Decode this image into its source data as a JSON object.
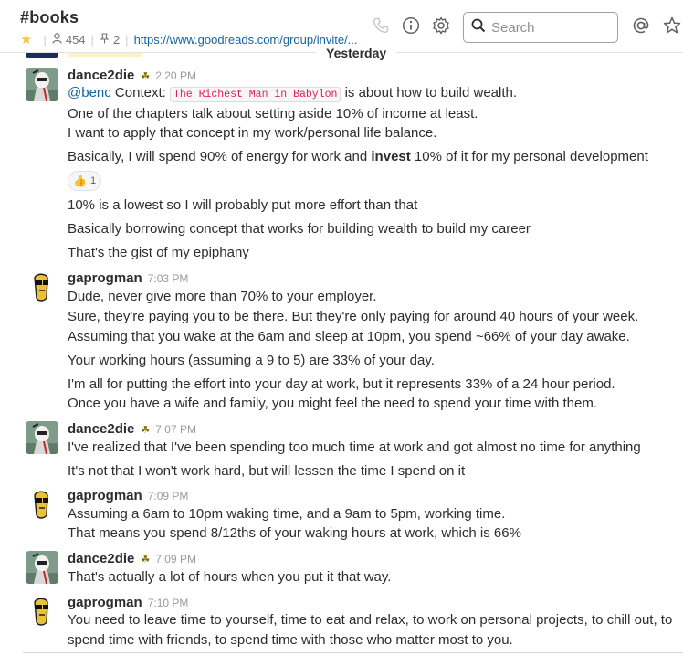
{
  "channel": {
    "title": "#books",
    "members": "454",
    "pins": "2",
    "link": "https://www.goodreads.com/group/invite/..."
  },
  "header": {
    "search_placeholder": "Search",
    "icons": [
      "phone-icon",
      "info-icon",
      "gear-icon",
      "search-icon",
      "at-icon",
      "star-icon"
    ]
  },
  "day_divider": "Yesterday",
  "messages": [
    {
      "sender": "dance2die",
      "time": "2:20 PM",
      "mention": "@benc",
      "context_prefix": " Context: ",
      "code": "The Richest Man in Babylon",
      "context_suffix": " is about how to build wealth.",
      "line2": "One of the chapters talk about setting aside 10% of income at least.",
      "line3": "I want to apply that concept in my work/personal life balance.",
      "line4_pre": "Basically, I will spend 90% of energy for work and ",
      "line4_bold": "invest",
      "line4_post": " 10% of it for my personal development",
      "reaction_count": "1",
      "line5": "10% is a lowest so I will probably put more effort than that",
      "line6": "Basically borrowing concept that works for building wealth to build my career",
      "line7": "That's the gist of my epiphany"
    },
    {
      "sender": "gaprogman",
      "time": "7:03 PM",
      "lines": [
        "Dude, never give more than 70% to your employer.",
        "Sure, they're paying you to be there. But they're only paying for around 40 hours of your week.",
        "Assuming that you wake at the 6am and sleep at 10pm, you spend ~66% of your day awake.",
        "Your working hours (assuming a 9 to 5) are 33% of your day.",
        "I'm all for putting the effort into your day at work, but it represents 33% of a 24 hour period.",
        "Once you have a wife and family, you might feel the need to spend your time with them."
      ]
    },
    {
      "sender": "dance2die",
      "time": "7:07 PM",
      "lines": [
        "I've realized that I've been spending too much time at work and got almost no time for anything",
        "It's not that I won't work hard, but will lessen the time I spend on it"
      ]
    },
    {
      "sender": "gaprogman",
      "time": "7:09 PM",
      "lines": [
        "Assuming a 6am to 10pm waking time, and a 9am to 5pm, working time.",
        "That means you spend 8/12ths of your waking hours at work, which is 66%"
      ]
    },
    {
      "sender": "dance2die",
      "time": "7:09 PM",
      "lines": [
        "That's actually a lot of hours when you put it that way."
      ]
    },
    {
      "sender": "gaprogman",
      "time": "7:10 PM",
      "lines": [
        "You need to leave time to yourself, time to eat and relax, to work on personal projects, to chill out, to",
        "spend time with friends, to spend time with those who matter most to you."
      ]
    }
  ]
}
